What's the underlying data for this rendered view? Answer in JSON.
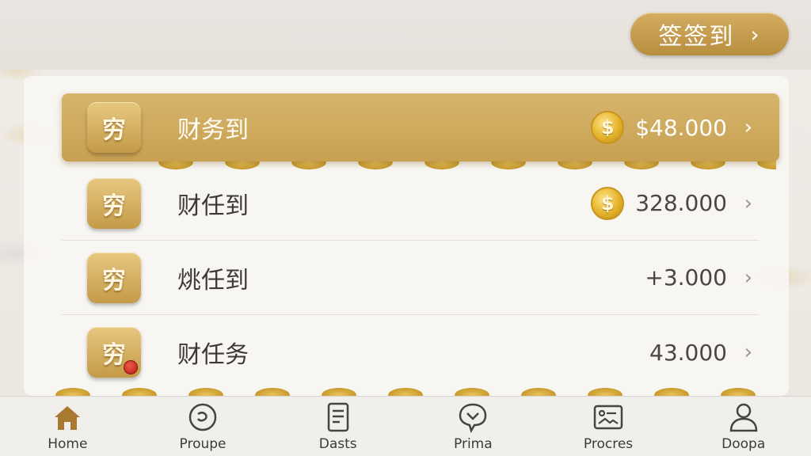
{
  "header": {
    "checkin_label": "签签到",
    "checkin_chevron": "›"
  },
  "rows": [
    {
      "icon_text": "穷",
      "label": "财务到",
      "value": "$48.000",
      "has_coin": true,
      "highlight": true
    },
    {
      "icon_text": "穷",
      "label": "财任到",
      "value": "328.000",
      "has_coin": true,
      "highlight": false
    },
    {
      "icon_text": "穷",
      "label": "烑任到",
      "value": "+3.000",
      "has_coin": false,
      "highlight": false
    },
    {
      "icon_text": "穷",
      "label": "财任务",
      "value": "43.000",
      "has_coin": false,
      "highlight": false,
      "badge": true
    }
  ],
  "coin_symbol": "$",
  "chevron": "›",
  "tabs": [
    {
      "label": "Home",
      "icon": "home-icon",
      "active": true
    },
    {
      "label": "Proupe",
      "icon": "circle-icon"
    },
    {
      "label": "Dasts",
      "icon": "document-icon"
    },
    {
      "label": "Prima",
      "icon": "chat-icon"
    },
    {
      "label": "Procres",
      "icon": "image-icon"
    },
    {
      "label": "Doopa",
      "icon": "user-icon"
    }
  ],
  "colors": {
    "gold": "#c7a052",
    "gold_light": "#d6b56c",
    "tab_active": "#a87a30"
  }
}
